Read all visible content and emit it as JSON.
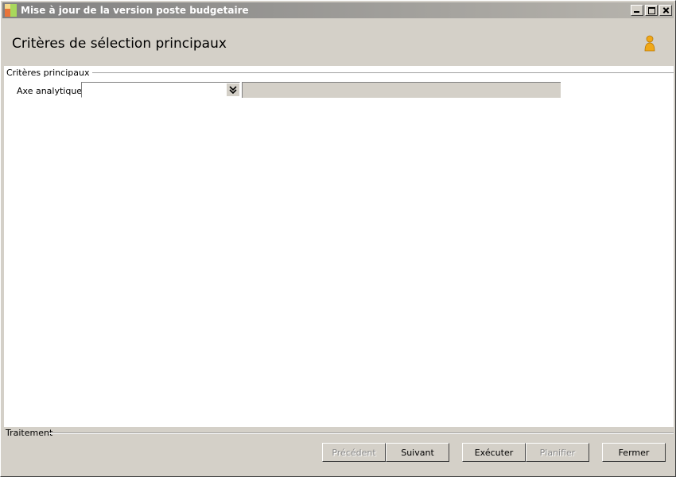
{
  "window": {
    "title": "Mise à jour de la version poste budgetaire"
  },
  "header": {
    "title": "Critères de sélection principaux",
    "user_icon": "user-icon"
  },
  "criteria": {
    "group_label": "Critères principaux",
    "axe_label": "Axe analytique :",
    "axe_value": "",
    "axe_description": ""
  },
  "footer": {
    "group_label": "Traitement",
    "buttons": {
      "precedent": "Précédent",
      "suivant": "Suivant",
      "executer": "Exécuter",
      "planifier": "Planifier",
      "fermer": "Fermer"
    }
  },
  "colors": {
    "window_bg": "#d4d0c8",
    "content_bg": "#ffffff",
    "titlebar_start": "#808080",
    "user_icon": "#f0a818"
  }
}
